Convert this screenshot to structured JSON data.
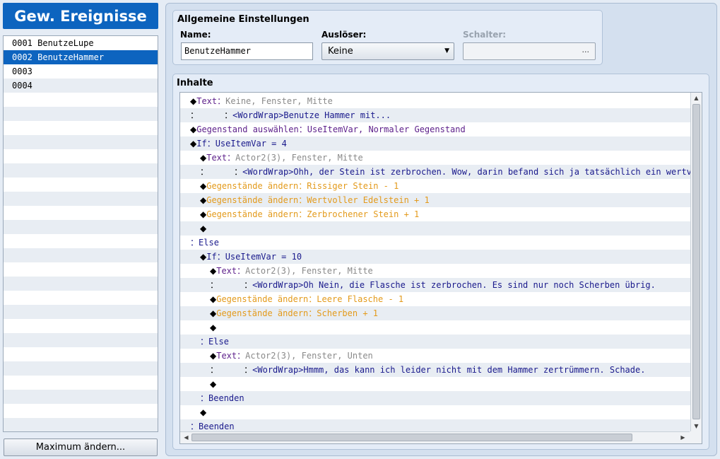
{
  "panel_title": "Gew. Ereignisse",
  "events": [
    {
      "label": "0001 BenutzeLupe",
      "selected": false
    },
    {
      "label": "0002 BenutzeHammer",
      "selected": true
    },
    {
      "label": "0003",
      "selected": false
    },
    {
      "label": "0004",
      "selected": false
    },
    {
      "label": "",
      "selected": false
    },
    {
      "label": "",
      "selected": false
    },
    {
      "label": "",
      "selected": false
    },
    {
      "label": "",
      "selected": false
    },
    {
      "label": "",
      "selected": false
    },
    {
      "label": "",
      "selected": false
    },
    {
      "label": "",
      "selected": false
    },
    {
      "label": "",
      "selected": false
    },
    {
      "label": "",
      "selected": false
    },
    {
      "label": "",
      "selected": false
    },
    {
      "label": "",
      "selected": false
    },
    {
      "label": "",
      "selected": false
    },
    {
      "label": "",
      "selected": false
    },
    {
      "label": "",
      "selected": false
    },
    {
      "label": "",
      "selected": false
    },
    {
      "label": "",
      "selected": false
    },
    {
      "label": "",
      "selected": false
    },
    {
      "label": "",
      "selected": false
    },
    {
      "label": "",
      "selected": false
    },
    {
      "label": "",
      "selected": false
    },
    {
      "label": "",
      "selected": false
    },
    {
      "label": "",
      "selected": false
    },
    {
      "label": "",
      "selected": false
    },
    {
      "label": "",
      "selected": false
    }
  ],
  "max_button": "Maximum ändern...",
  "general": {
    "title": "Allgemeine Einstellungen",
    "name_label": "Name:",
    "name_value": "BenutzeHammer",
    "trigger_label": "Auslöser:",
    "trigger_value": "Keine",
    "switch_label": "Schalter:",
    "switch_button": "..."
  },
  "contents": {
    "title": "Inhalte",
    "commands": [
      {
        "indent": 0,
        "parts": [
          {
            "t": "◆",
            "c": "black"
          },
          {
            "t": "Text",
            "c": "purple"
          },
          {
            "t": "：",
            "c": "purple"
          },
          {
            "t": "Keine, Fenster, Mitte",
            "c": "gray"
          }
        ]
      },
      {
        "indent": 0,
        "parts": [
          {
            "t": "：",
            "c": "black"
          },
          {
            "t": "     ：",
            "c": "black"
          },
          {
            "t": "<WordWrap>Benutze Hammer mit...",
            "c": "navy"
          }
        ]
      },
      {
        "indent": 0,
        "parts": [
          {
            "t": "◆",
            "c": "black"
          },
          {
            "t": "Gegenstand auswählen",
            "c": "purple"
          },
          {
            "t": "：",
            "c": "purple"
          },
          {
            "t": "UseItemVar, Normaler Gegenstand",
            "c": "purple"
          }
        ]
      },
      {
        "indent": 0,
        "parts": [
          {
            "t": "◆",
            "c": "black"
          },
          {
            "t": "If",
            "c": "navy"
          },
          {
            "t": "：",
            "c": "navy"
          },
          {
            "t": "UseItemVar = 4",
            "c": "navy"
          }
        ]
      },
      {
        "indent": 1,
        "parts": [
          {
            "t": "◆",
            "c": "black"
          },
          {
            "t": "Text",
            "c": "purple"
          },
          {
            "t": "：",
            "c": "purple"
          },
          {
            "t": "Actor2(3), Fenster, Mitte",
            "c": "gray"
          }
        ]
      },
      {
        "indent": 1,
        "parts": [
          {
            "t": "：",
            "c": "black"
          },
          {
            "t": "     ：",
            "c": "black"
          },
          {
            "t": "<WordWrap>Ohh, der Stein ist zerbrochen. Wow, darin befand sich ja tatsächlich ein wertvoller E",
            "c": "navy"
          }
        ]
      },
      {
        "indent": 1,
        "parts": [
          {
            "t": "◆",
            "c": "black"
          },
          {
            "t": "Gegenstände ändern",
            "c": "orange"
          },
          {
            "t": "：",
            "c": "orange"
          },
          {
            "t": "Rissiger Stein - 1",
            "c": "orange"
          }
        ]
      },
      {
        "indent": 1,
        "parts": [
          {
            "t": "◆",
            "c": "black"
          },
          {
            "t": "Gegenstände ändern",
            "c": "orange"
          },
          {
            "t": "：",
            "c": "orange"
          },
          {
            "t": "Wertvoller Edelstein + 1",
            "c": "orange"
          }
        ]
      },
      {
        "indent": 1,
        "parts": [
          {
            "t": "◆",
            "c": "black"
          },
          {
            "t": "Gegenstände ändern",
            "c": "orange"
          },
          {
            "t": "：",
            "c": "orange"
          },
          {
            "t": "Zerbrochener Stein + 1",
            "c": "orange"
          }
        ]
      },
      {
        "indent": 1,
        "parts": [
          {
            "t": "◆",
            "c": "black"
          }
        ]
      },
      {
        "indent": 0,
        "parts": [
          {
            "t": "：",
            "c": "navy"
          },
          {
            "t": "Else",
            "c": "navy"
          }
        ]
      },
      {
        "indent": 1,
        "parts": [
          {
            "t": "◆",
            "c": "black"
          },
          {
            "t": "If",
            "c": "navy"
          },
          {
            "t": "：",
            "c": "navy"
          },
          {
            "t": "UseItemVar = 10",
            "c": "navy"
          }
        ]
      },
      {
        "indent": 2,
        "parts": [
          {
            "t": "◆",
            "c": "black"
          },
          {
            "t": "Text",
            "c": "purple"
          },
          {
            "t": "：",
            "c": "purple"
          },
          {
            "t": "Actor2(3), Fenster, Mitte",
            "c": "gray"
          }
        ]
      },
      {
        "indent": 2,
        "parts": [
          {
            "t": "：",
            "c": "black"
          },
          {
            "t": "     ：",
            "c": "black"
          },
          {
            "t": "<WordWrap>Oh Nein, die Flasche ist zerbrochen. Es sind nur noch Scherben übrig.",
            "c": "navy"
          }
        ]
      },
      {
        "indent": 2,
        "parts": [
          {
            "t": "◆",
            "c": "black"
          },
          {
            "t": "Gegenstände ändern",
            "c": "orange"
          },
          {
            "t": "：",
            "c": "orange"
          },
          {
            "t": "Leere Flasche - 1",
            "c": "orange"
          }
        ]
      },
      {
        "indent": 2,
        "parts": [
          {
            "t": "◆",
            "c": "black"
          },
          {
            "t": "Gegenstände ändern",
            "c": "orange"
          },
          {
            "t": "：",
            "c": "orange"
          },
          {
            "t": "Scherben + 1",
            "c": "orange"
          }
        ]
      },
      {
        "indent": 2,
        "parts": [
          {
            "t": "◆",
            "c": "black"
          }
        ]
      },
      {
        "indent": 1,
        "parts": [
          {
            "t": "：",
            "c": "navy"
          },
          {
            "t": "Else",
            "c": "navy"
          }
        ]
      },
      {
        "indent": 2,
        "parts": [
          {
            "t": "◆",
            "c": "black"
          },
          {
            "t": "Text",
            "c": "purple"
          },
          {
            "t": "：",
            "c": "purple"
          },
          {
            "t": "Actor2(3), Fenster, Unten",
            "c": "gray"
          }
        ]
      },
      {
        "indent": 2,
        "parts": [
          {
            "t": "：",
            "c": "black"
          },
          {
            "t": "     ：",
            "c": "black"
          },
          {
            "t": "<WordWrap>Hmmm, das kann ich leider nicht mit dem Hammer zertrümmern. Schade.",
            "c": "navy"
          }
        ]
      },
      {
        "indent": 2,
        "parts": [
          {
            "t": "◆",
            "c": "black"
          }
        ]
      },
      {
        "indent": 1,
        "parts": [
          {
            "t": "：",
            "c": "navy"
          },
          {
            "t": "Beenden",
            "c": "navy"
          }
        ]
      },
      {
        "indent": 1,
        "parts": [
          {
            "t": "◆",
            "c": "black"
          }
        ]
      },
      {
        "indent": 0,
        "parts": [
          {
            "t": "：",
            "c": "navy"
          },
          {
            "t": "Beenden",
            "c": "navy"
          }
        ]
      }
    ]
  },
  "icons": {
    "dropdown": "chevron-down-icon",
    "scroll_up": "scroll-up-arrow-icon",
    "scroll_down": "scroll-down-arrow-icon",
    "scroll_left": "scroll-left-arrow-icon",
    "scroll_right": "scroll-right-arrow-icon"
  }
}
